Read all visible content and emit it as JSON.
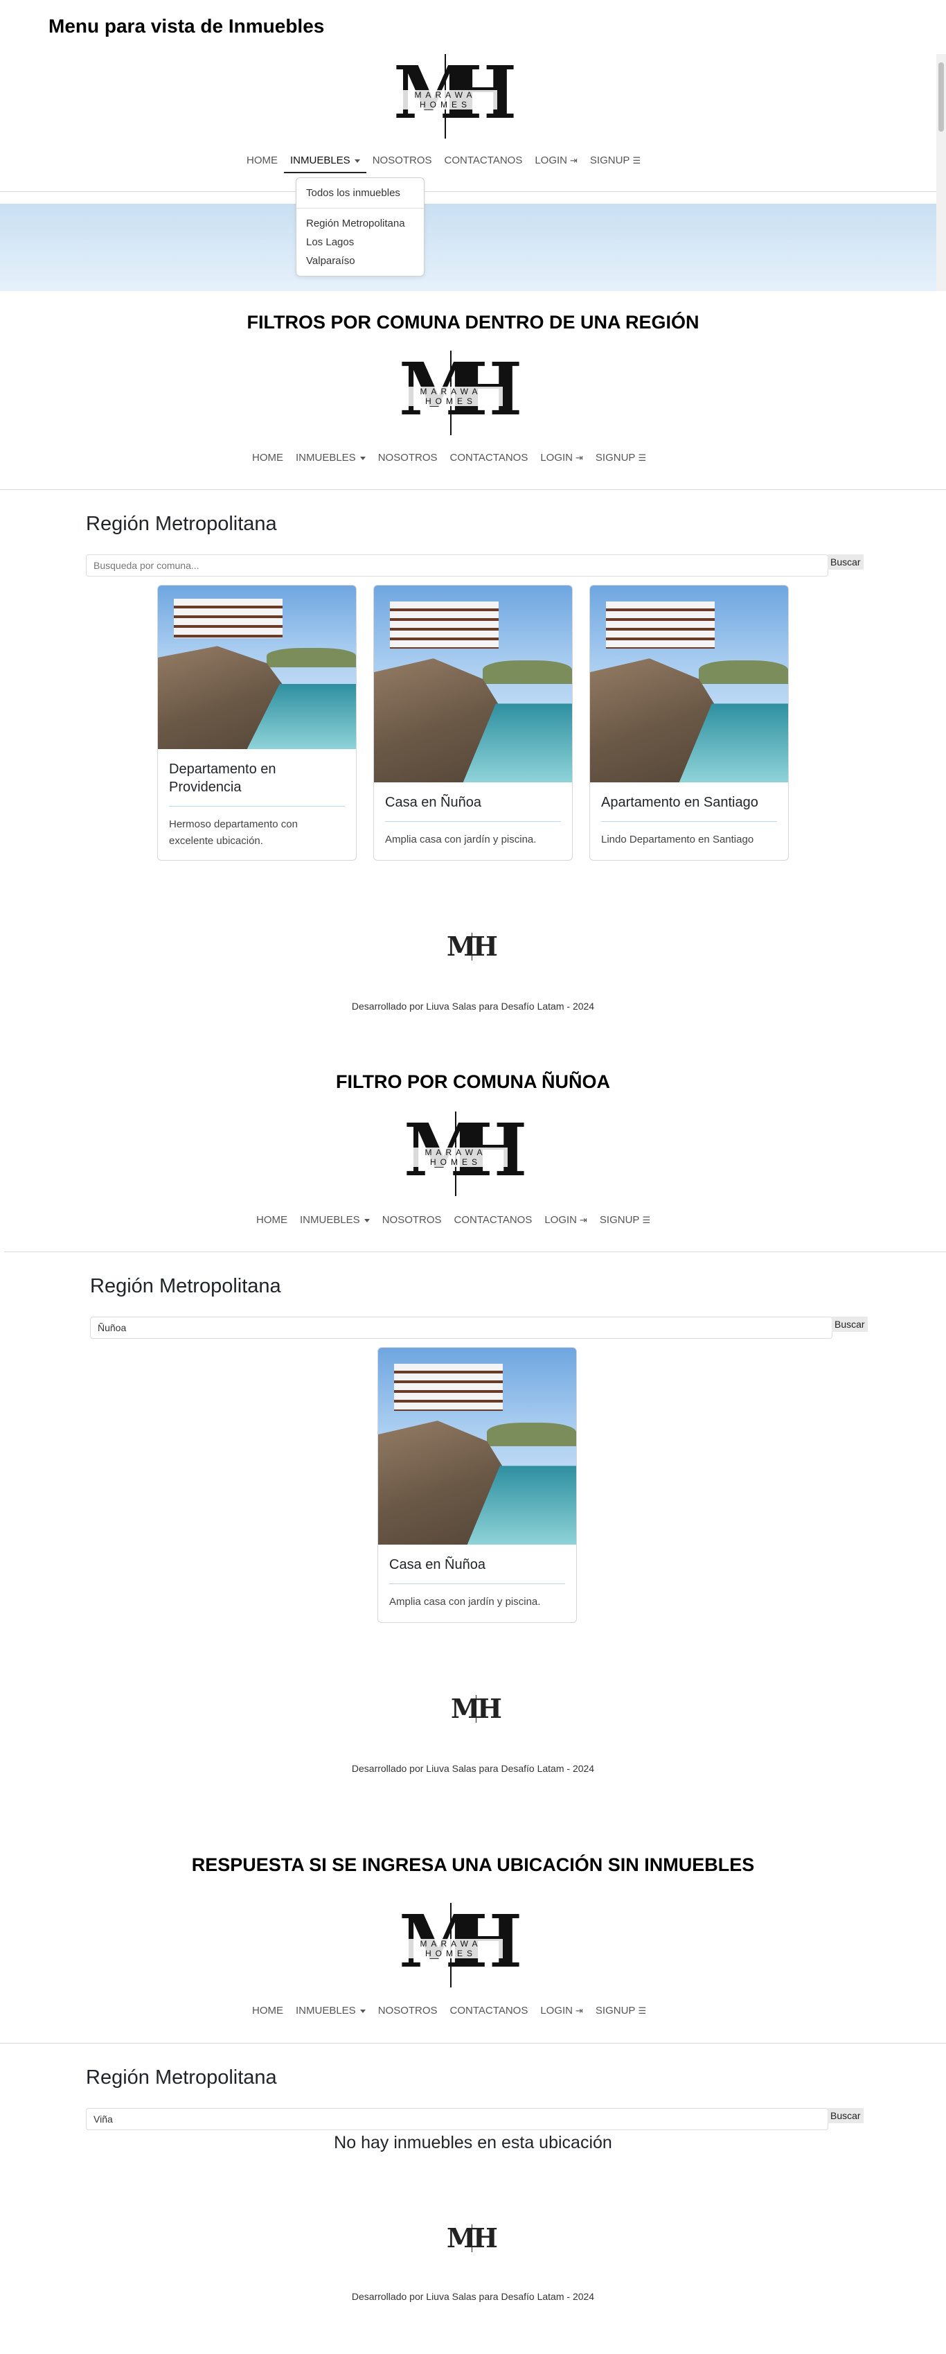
{
  "page_heading": "Menu para vista de Inmuebles",
  "logo": {
    "letter_m": "M",
    "letter_h": "H",
    "brand": "MARAWA HOMES"
  },
  "nav": {
    "home": "HOME",
    "inmuebles": "INMUEBLES",
    "nosotros": "NOSOTROS",
    "contactanos": "CONTACTANOS",
    "login": "LOGIN",
    "signup": "SIGNUP"
  },
  "dropdown": {
    "all": "Todos los inmuebles",
    "items": [
      "Región Metropolitana",
      "Los Lagos",
      "Valparaíso"
    ]
  },
  "sections": [
    {
      "title": "FILTROS POR COMUNA DENTRO DE UNA REGIÓN",
      "region": "Región Metropolitana",
      "search_value": "",
      "search_placeholder": "Busqueda por comuna...",
      "search_button": "Buscar",
      "cards": [
        {
          "title": "Departamento en Providencia",
          "text": "Hermoso departamento con excelente ubicación."
        },
        {
          "title": "Casa en Ñuñoa",
          "text": "Amplia casa con jardín y piscina."
        },
        {
          "title": "Apartamento en Santiago",
          "text": "Lindo Departamento en Santiago"
        }
      ]
    },
    {
      "title": "FILTRO POR COMUNA ÑUÑOA",
      "region": "Región Metropolitana",
      "search_value": "Ñuñoa",
      "search_placeholder": "Busqueda por comuna...",
      "search_button": "Buscar",
      "cards": [
        {
          "title": "Casa en Ñuñoa",
          "text": "Amplia casa con jardín y piscina."
        }
      ]
    },
    {
      "title": "RESPUESTA SI SE INGRESA UNA UBICACIÓN SIN INMUEBLES",
      "region": "Región Metropolitana",
      "search_value": "Viña",
      "search_placeholder": "Busqueda por comuna...",
      "search_button": "Buscar",
      "empty_message": "No hay inmuebles en esta ubicación"
    }
  ],
  "footer": "Desarrollado por Liuva Salas para Desafío Latam - 2024"
}
